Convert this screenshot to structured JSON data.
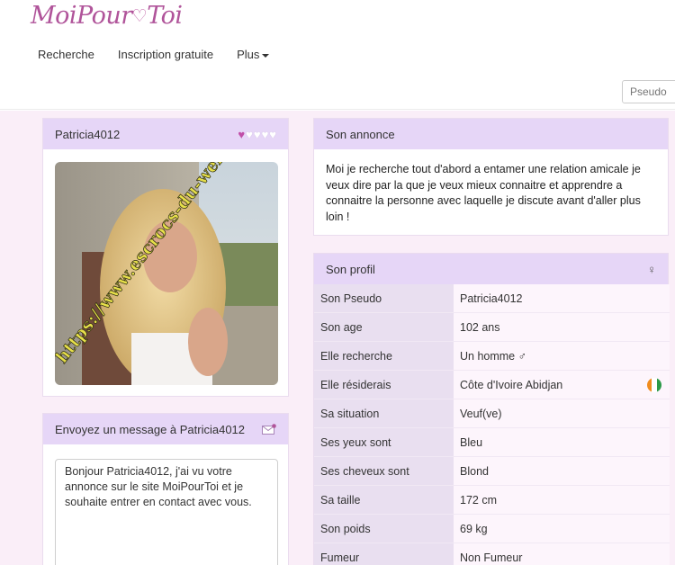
{
  "header": {
    "logo_left": "MoiPour",
    "logo_heart": "♡",
    "logo_right": "Toi",
    "nav": [
      "Recherche",
      "Inscription gratuite",
      "Plus"
    ],
    "search_placeholder": "Pseudo"
  },
  "profile_card": {
    "username": "Patricia4012",
    "hearts_full": 1,
    "hearts_total": 5,
    "watermark": "https://www.escrocs-du-web.fr"
  },
  "message": {
    "title": "Envoyez un message à Patricia4012",
    "text": "Bonjour Patricia4012, j'ai vu votre annonce sur le site MoiPourToi et je souhaite entrer en contact avec vous."
  },
  "annonce": {
    "title": "Son annonce",
    "text": "Moi je recherche tout d'abord a entamer une relation amicale je veux dire par la que je veux mieux connaitre et apprendre a connaitre la personne avec laquelle je discute avant d'aller plus loin !"
  },
  "profil": {
    "title": "Son profil",
    "gender_symbol": "♀",
    "rows": [
      {
        "label": "Son Pseudo",
        "value": "Patricia4012"
      },
      {
        "label": "Son age",
        "value": "102 ans"
      },
      {
        "label": "Elle recherche",
        "value": "Un homme ♂"
      },
      {
        "label": "Elle résiderais",
        "value": "Côte d'Ivoire Abidjan"
      },
      {
        "label": "Sa situation",
        "value": "Veuf(ve)"
      },
      {
        "label": "Ses yeux sont",
        "value": "Bleu"
      },
      {
        "label": "Ses cheveux sont",
        "value": "Blond"
      },
      {
        "label": "Sa taille",
        "value": "172 cm"
      },
      {
        "label": "Son poids",
        "value": "69 kg"
      },
      {
        "label": "Fumeur",
        "value": "Non Fumeur"
      }
    ]
  },
  "colors": {
    "accent": "#b0549a",
    "panel_header": "#e6d6f7",
    "page_bg": "#faeef8"
  }
}
